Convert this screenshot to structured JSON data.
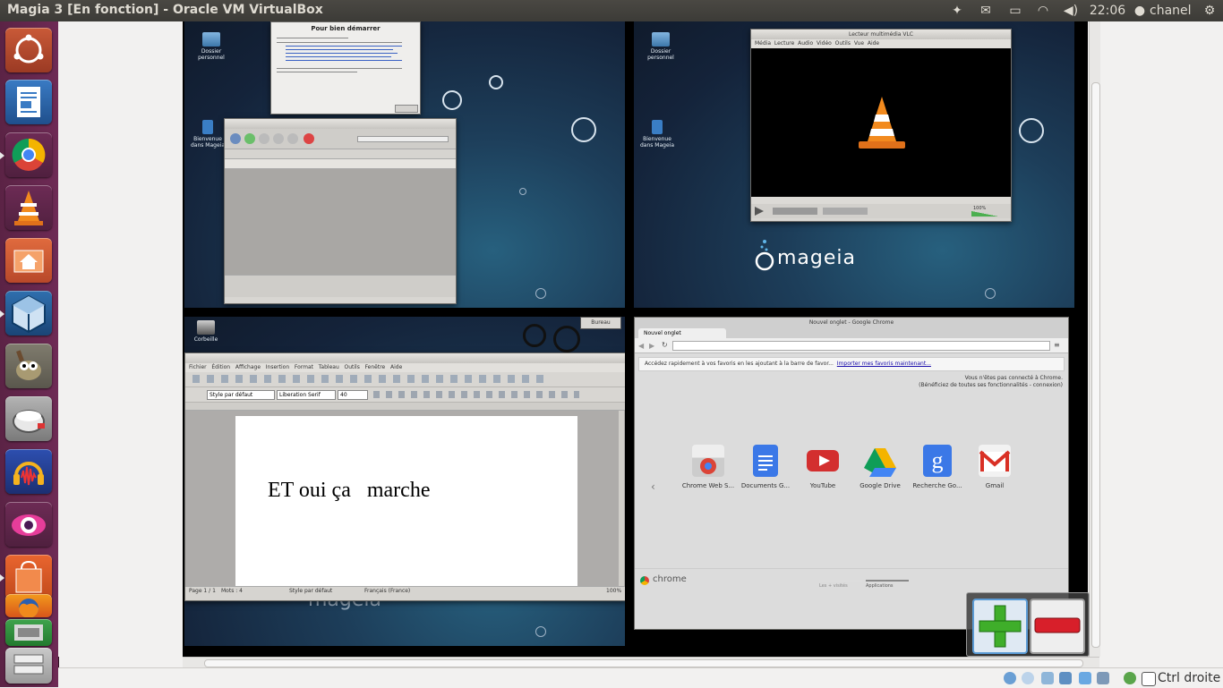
{
  "window": {
    "title": "Magia 3 [En fonction] - Oracle VM VirtualBox"
  },
  "topbar": {
    "time": "22:06",
    "user": "chanel"
  },
  "launcher": {
    "items": [
      "ubuntu-dash-icon",
      "libreoffice-writer-icon",
      "chrome-icon",
      "vlc-icon",
      "files-icon",
      "virtualbox-icon",
      "gimp-icon",
      "bowl-icon",
      "audacity-icon",
      "eye-icon",
      "software-center-icon",
      "firefox-icon",
      "stacked-app-icon",
      "drives-icon"
    ]
  },
  "vm": {
    "q1": {
      "welcome_title": "Pour bien démarrer",
      "desktop_icons": [
        "Dossier personnel",
        "Bienvenue dans Mageia"
      ]
    },
    "q2": {
      "vlc_title": "Lecteur multimédia VLC",
      "vlc_menu": [
        "Média",
        "Lecture",
        "Audio",
        "Vidéo",
        "Outils",
        "Vue",
        "Aide"
      ],
      "vlc_volume": "100%",
      "desktop_icons": [
        "Dossier personnel",
        "Bienvenue dans Mageia"
      ],
      "logo_text": "mageia"
    },
    "q3": {
      "writer_menu": [
        "Fichier",
        "Édition",
        "Affichage",
        "Insertion",
        "Format",
        "Tableau",
        "Outils",
        "Fenêtre",
        "Aide"
      ],
      "style": "Style par défaut",
      "font": "Liberation Serif",
      "size": "40",
      "doc_text": "ET oui ça   marche",
      "status_page": "Page 1 / 1",
      "status_words": "Mots : 4",
      "status_style": "Style par défaut",
      "status_lang": "Français (France)",
      "status_zoom": "100%",
      "taskbar_label": "Bureau",
      "desktop_icon": "Corbeille",
      "logo_text": "mageia"
    },
    "q4": {
      "chrome_title": "Nouvel onglet - Google Chrome",
      "tab_label": "Nouvel onglet",
      "bookmark_msg": "Accédez rapidement à vos favoris en les ajoutant à la barre de favor...",
      "bookmark_link": "Importer mes favoris maintenant...",
      "signin_line1": "Vous n'êtes pas connecté à Chrome.",
      "signin_line2": "(Bénéficiez de toutes ses fonctionnalités - connexion)",
      "apps": [
        "Chrome Web S...",
        "Documents G...",
        "YouTube",
        "Google Drive",
        "Recherche Go...",
        "Gmail"
      ],
      "footer_brand": "chrome",
      "footer_tabs": [
        "Les + visités",
        "Applications"
      ]
    }
  },
  "statusbar": {
    "host_key": "Ctrl droite"
  },
  "colors": {
    "topbar": "#3c3b37",
    "launcher": "#6e2a55",
    "vm_bg": "#1d3e5a",
    "accent_orange": "#f28a1e"
  }
}
